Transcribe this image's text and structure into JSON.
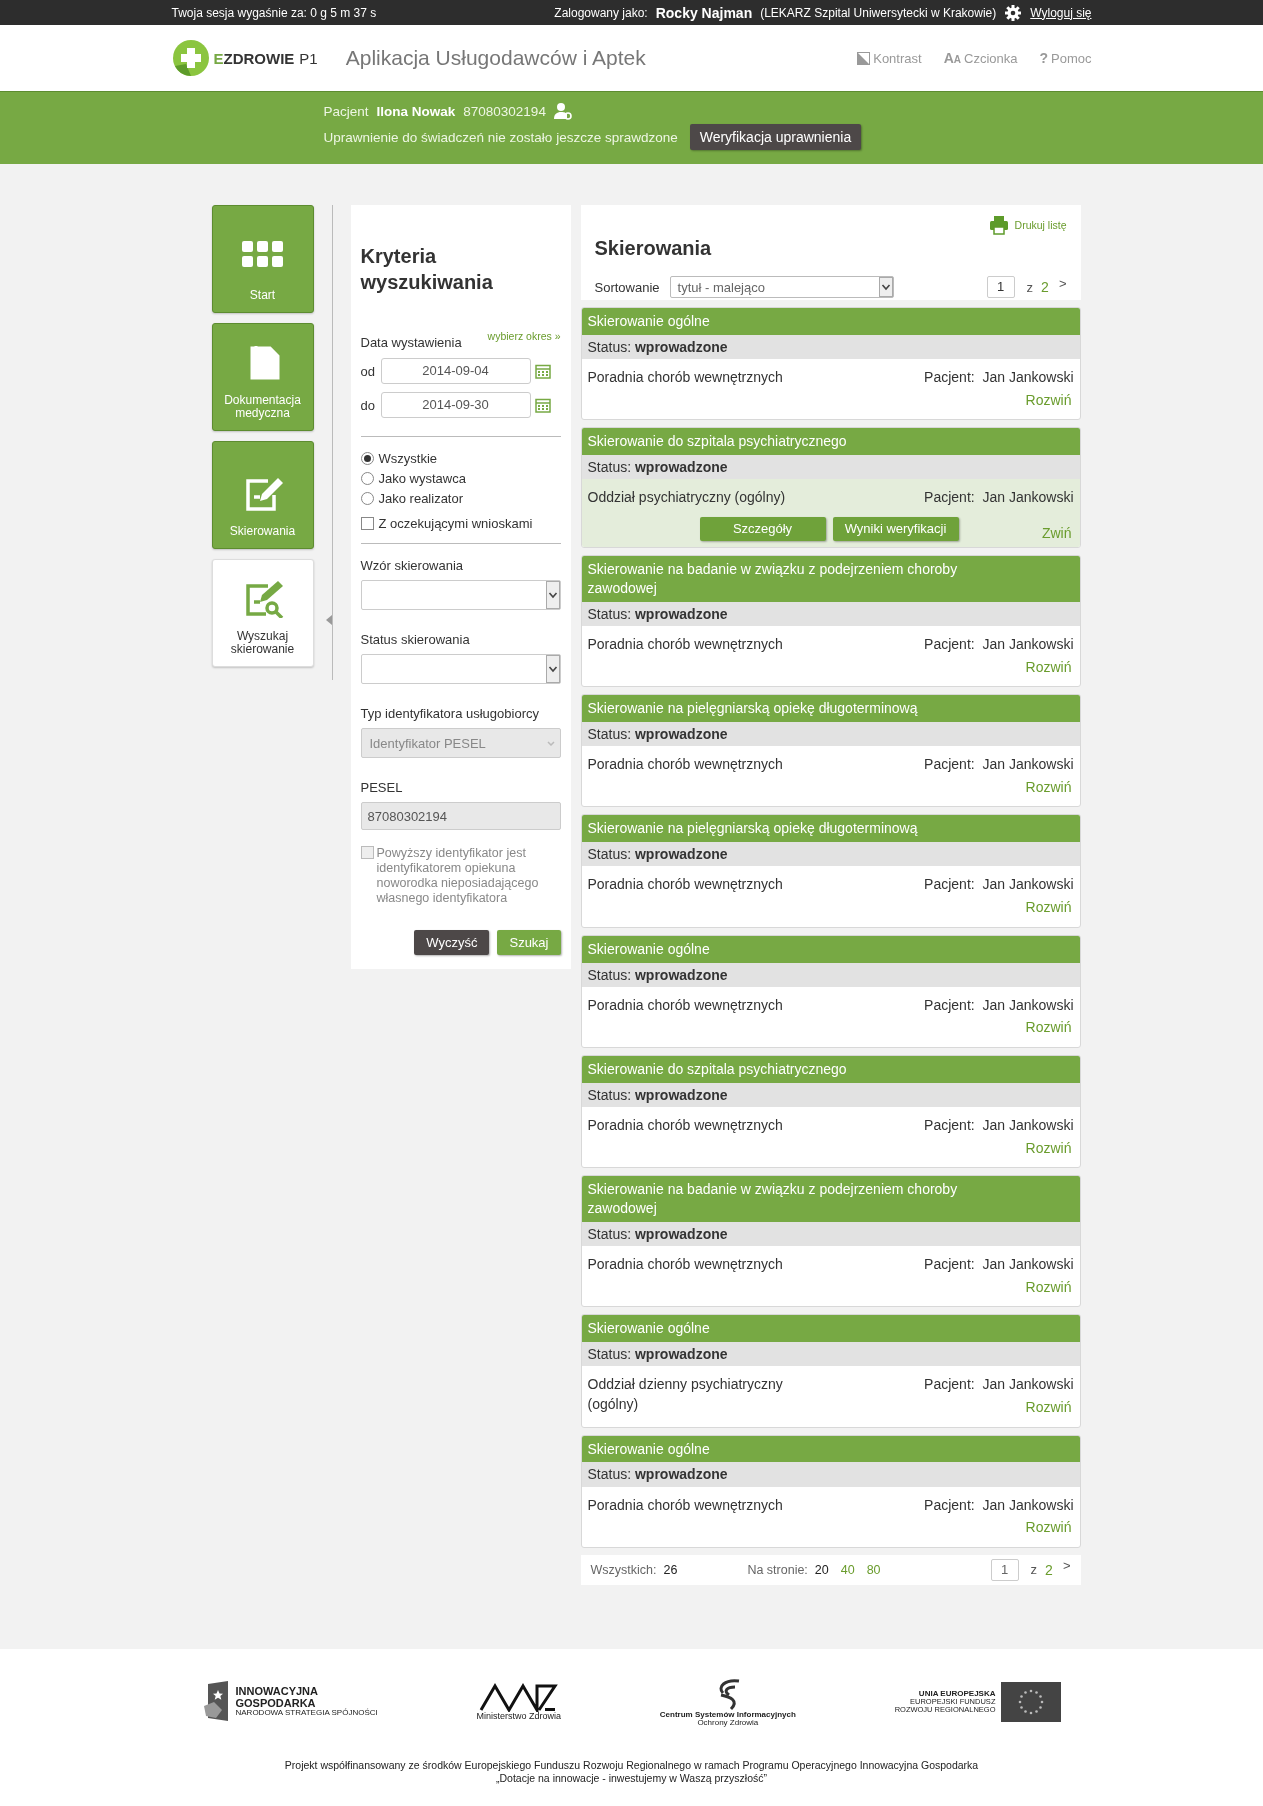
{
  "session_bar": {
    "session_text": "Twoja sesja wygaśnie za: 0 g 5 m 37 s",
    "logged_label": "Zalogowany jako:",
    "user_name": "Rocky Najman",
    "user_role": "(LEKARZ Szpital Uniwersytecki w Krakowie)",
    "logout": "Wyloguj się"
  },
  "header": {
    "logo_text": "EZDROWIE",
    "logo_suffix": "P1",
    "app_title": "Aplikacja Usługodawców i Aptek",
    "tools": [
      {
        "kind": "contrast",
        "label": "Kontrast"
      },
      {
        "kind": "font",
        "icon": "AA",
        "label": "Czcionka"
      },
      {
        "kind": "help",
        "icon": "?",
        "label": "Pomoc"
      }
    ]
  },
  "patient_band": {
    "label": "Pacjent",
    "name": "Ilona Nowak",
    "pesel": "87080302194",
    "eligibility_text": "Uprawnienie do świadczeń nie zostało jeszcze sprawdzone",
    "verify_button": "Weryfikacja uprawnienia"
  },
  "sidebar": {
    "items": [
      {
        "kind": "grid",
        "label": "Start",
        "selected": false
      },
      {
        "kind": "document",
        "label": "Dokumentacja medyczna",
        "selected": false
      },
      {
        "kind": "referral",
        "label": "Skierowania",
        "selected": false
      },
      {
        "kind": "search-referral",
        "label": "Wyszukaj skierowanie",
        "selected": true
      }
    ]
  },
  "criteria": {
    "title": "Kryteria wyszukiwania",
    "date_label": "Data wystawienia",
    "pick_period": "wybierz okres »",
    "dates": [
      {
        "label": "od",
        "value": "2014-09-04"
      },
      {
        "label": "do",
        "value": "2014-09-30"
      }
    ],
    "radios": [
      {
        "label": "Wszystkie",
        "selected": true
      },
      {
        "label": "Jako wystawca",
        "selected": false
      },
      {
        "label": "Jako realizator",
        "selected": false
      }
    ],
    "pending_checkbox": {
      "label": "Z oczekującymi wnioskami",
      "checked": false
    },
    "fields": [
      {
        "kind": "select",
        "label": "Wzór skierowania",
        "disabled": false
      },
      {
        "kind": "select",
        "label": "Status skierowania",
        "disabled": false
      },
      {
        "kind": "select",
        "label": "Typ identyfikatora usługobiorcy",
        "value": "Identyfikator PESEL",
        "disabled": true
      },
      {
        "kind": "text",
        "label": "PESEL",
        "value": "87080302194",
        "disabled": true
      }
    ],
    "guardian_checkbox": {
      "label": "Powyższy identyfikator jest identyfikatorem opiekuna noworodka nieposiadającego własnego identyfikatora",
      "checked": false,
      "disabled": true
    },
    "buttons": [
      {
        "kind": "secondary",
        "label": "Wyczyść"
      },
      {
        "kind": "primary",
        "label": "Szukaj"
      }
    ]
  },
  "referrals": {
    "title": "Skierowania",
    "print": "Drukuj listę",
    "sort_label": "Sortowanie",
    "sort_value": "tytuł - malejąco",
    "pager": {
      "page": "1",
      "of": "z",
      "total": "2",
      "next": ">"
    },
    "items": [
      {
        "title": "Skierowanie ogólne",
        "status_label": "Status:",
        "status": "wprowadzone",
        "unit": "Poradnia chorób wewnętrznych",
        "patient_label": "Pacjent:",
        "patient": "Jan Jankowski",
        "expanded": false,
        "toggle": "Rozwiń"
      },
      {
        "title": "Skierowanie do szpitala psychiatrycznego",
        "status_label": "Status:",
        "status": "wprowadzone",
        "unit": "Oddział psychiatryczny (ogólny)",
        "patient_label": "Pacjent:",
        "patient": "Jan Jankowski",
        "expanded": true,
        "buttons": [
          "Szczegóły",
          "Wyniki weryfikacji"
        ],
        "toggle": "Zwiń"
      },
      {
        "title": "Skierowanie na badanie w związku z podejrzeniem choroby zawodowej",
        "status_label": "Status:",
        "status": "wprowadzone",
        "unit": "Poradnia chorób wewnętrznych",
        "patient_label": "Pacjent:",
        "patient": "Jan Jankowski",
        "expanded": false,
        "toggle": "Rozwiń"
      },
      {
        "title": "Skierowanie na pielęgniarską opiekę długoterminową",
        "status_label": "Status:",
        "status": "wprowadzone",
        "unit": "Poradnia chorób wewnętrznych",
        "patient_label": "Pacjent:",
        "patient": "Jan Jankowski",
        "expanded": false,
        "toggle": "Rozwiń"
      },
      {
        "title": "Skierowanie na pielęgniarską opiekę długoterminową",
        "status_label": "Status:",
        "status": "wprowadzone",
        "unit": "Poradnia chorób wewnętrznych",
        "patient_label": "Pacjent:",
        "patient": "Jan Jankowski",
        "expanded": false,
        "toggle": "Rozwiń"
      },
      {
        "title": "Skierowanie ogólne",
        "status_label": "Status:",
        "status": "wprowadzone",
        "unit": "Poradnia chorób wewnętrznych",
        "patient_label": "Pacjent:",
        "patient": "Jan Jankowski",
        "expanded": false,
        "toggle": "Rozwiń"
      },
      {
        "title": "Skierowanie do szpitala psychiatrycznego",
        "status_label": "Status:",
        "status": "wprowadzone",
        "unit": "Poradnia chorób wewnętrznych",
        "patient_label": "Pacjent:",
        "patient": "Jan Jankowski",
        "expanded": false,
        "toggle": "Rozwiń"
      },
      {
        "title": "Skierowanie na badanie w związku z podejrzeniem choroby zawodowej",
        "status_label": "Status:",
        "status": "wprowadzone",
        "unit": "Poradnia chorób wewnętrznych",
        "patient_label": "Pacjent:",
        "patient": "Jan Jankowski",
        "expanded": false,
        "toggle": "Rozwiń"
      },
      {
        "title": "Skierowanie ogólne",
        "status_label": "Status:",
        "status": "wprowadzone",
        "unit": "Oddział dzienny psychiatryczny (ogólny)",
        "patient_label": "Pacjent:",
        "patient": "Jan Jankowski",
        "expanded": false,
        "toggle": "Rozwiń"
      },
      {
        "title": "Skierowanie ogólne",
        "status_label": "Status:",
        "status": "wprowadzone",
        "unit": "Poradnia chorób wewnętrznych",
        "patient_label": "Pacjent:",
        "patient": "Jan Jankowski",
        "expanded": false,
        "toggle": "Rozwiń"
      }
    ],
    "summary": {
      "total_label": "Wszystkich:",
      "total": "26",
      "per_page_label": "Na stronie:",
      "per_page": [
        {
          "label": "20",
          "selected": true
        },
        {
          "label": "40",
          "selected": false
        },
        {
          "label": "80",
          "selected": false
        }
      ]
    },
    "bottom_pager": {
      "page": "1",
      "of": "z",
      "total": "2",
      "next": ">"
    }
  },
  "footer": {
    "logos": [
      {
        "kind": "innovation",
        "lines": [
          "INNOWACYJNA",
          "GOSPODARKA",
          "NARODOWA STRATEGIA SPÓJNOŚCI"
        ]
      },
      {
        "kind": "ministry",
        "lines": [
          "Ministerstwo Zdrowia"
        ]
      },
      {
        "kind": "csioz",
        "lines": [
          "Centrum Systemów Informacyjnych",
          "Ochrony Zdrowia"
        ]
      },
      {
        "kind": "eu",
        "lines": [
          "UNIA EUROPEJSKA",
          "EUROPEJSKI FUNDUSZ",
          "ROZWOJU REGIONALNEGO"
        ]
      }
    ],
    "text_lines": [
      "Projekt współfinansowany ze środków Europejskiego Funduszu Rozwoju Regionalnego w ramach Programu Operacyjnego Innowacyjna Gospodarka",
      "„Dotacje na innowacje - inwestujemy w Waszą przyszłość”"
    ]
  }
}
